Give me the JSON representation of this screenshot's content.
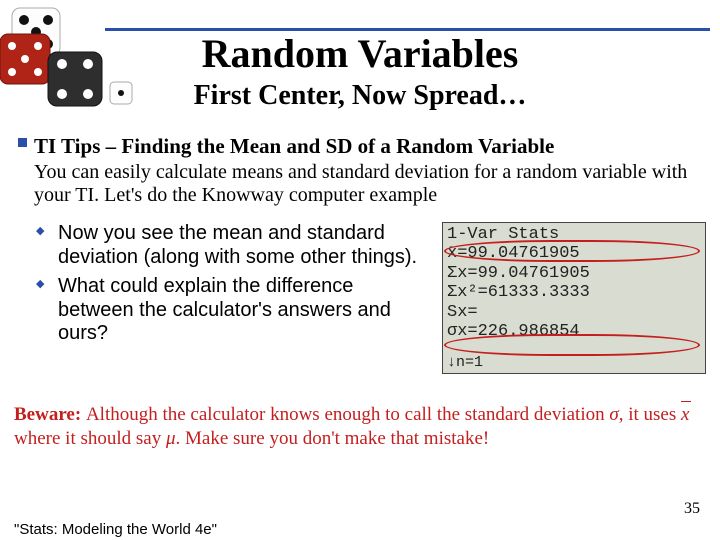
{
  "title": "Random Variables",
  "subtitle": "First Center, Now Spread…",
  "section_heading": "TI Tips – Finding the Mean and SD of a Random Variable",
  "section_body": "You can easily calculate means and standard deviation for a random variable with your TI. Let's do the Knowway computer example",
  "bullets": [
    "Now you see the mean and standard deviation (along with some other things).",
    "What could explain the difference between the calculator's answers and ours?"
  ],
  "calc": {
    "line1": "1-Var Stats",
    "line2": "x̄=99.04761905",
    "line3": "Σx=99.04761905",
    "line4": "Σx²=61333.3333",
    "line5": "Sx=",
    "line6": "σx=226.986854",
    "line7": "↓n=1"
  },
  "beware_prefix": "Beware: ",
  "beware_text1": "Although the calculator knows enough to call the standard deviation ",
  "beware_sigma": "σ",
  "beware_text2": ", it uses ",
  "beware_xbar": "x",
  "beware_text3": " where it should say ",
  "beware_mu": "μ",
  "beware_text4": ". Make sure you don't make that mistake!",
  "page_number": "35",
  "footer": "\"Stats: Modeling the World 4e\""
}
